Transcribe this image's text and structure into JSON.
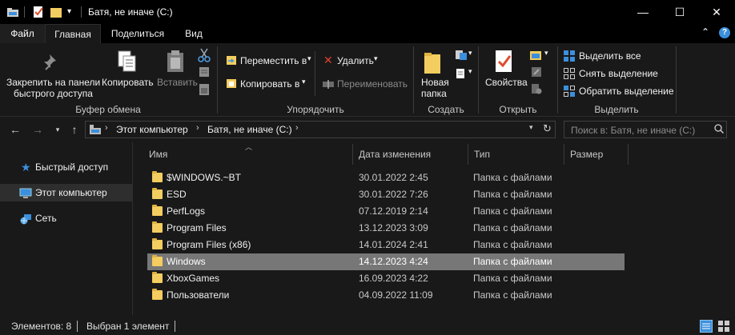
{
  "window": {
    "title": "Батя, не иначе (C:)",
    "minimize_glyph": "—",
    "maximize_glyph": "☐",
    "close_glyph": "✕"
  },
  "ribbon_tabs": {
    "file": "Файл",
    "home": "Главная",
    "share": "Поделиться",
    "view": "Вид"
  },
  "ribbon": {
    "pin_line1": "Закрепить на панели",
    "pin_line2": "быстрого доступа",
    "copy": "Копировать",
    "paste": "Вставить",
    "clipboard_group": "Буфер обмена",
    "move_to": "Переместить в",
    "copy_to": "Копировать в",
    "delete": "Удалить",
    "rename": "Переименовать",
    "organize_group": "Упорядочить",
    "new_folder_line1": "Новая",
    "new_folder_line2": "папка",
    "create_group": "Создать",
    "properties": "Свойства",
    "open_group": "Открыть",
    "select_all": "Выделить все",
    "select_none": "Снять выделение",
    "invert_selection": "Обратить выделение",
    "select_group": "Выделить"
  },
  "address": {
    "crumb1": "Этот компьютер",
    "crumb2": "Батя, не иначе (C:)",
    "search_placeholder": "Поиск в: Батя, не иначе (C:)"
  },
  "nav": {
    "quick_access": "Быстрый доступ",
    "this_pc": "Этот компьютер",
    "network": "Сеть"
  },
  "columns": {
    "name": "Имя",
    "date": "Дата изменения",
    "type": "Тип",
    "size": "Размер"
  },
  "files": [
    {
      "name": "$WINDOWS.~BT",
      "date": "30.01.2022 2:45",
      "type": "Папка с файлами"
    },
    {
      "name": "ESD",
      "date": "30.01.2022 7:26",
      "type": "Папка с файлами"
    },
    {
      "name": "PerfLogs",
      "date": "07.12.2019 2:14",
      "type": "Папка с файлами"
    },
    {
      "name": "Program Files",
      "date": "13.12.2023 3:09",
      "type": "Папка с файлами"
    },
    {
      "name": "Program Files (x86)",
      "date": "14.01.2024 2:41",
      "type": "Папка с файлами"
    },
    {
      "name": "Windows",
      "date": "14.12.2023 4:24",
      "type": "Папка с файлами"
    },
    {
      "name": "XboxGames",
      "date": "16.09.2023 4:22",
      "type": "Папка с файлами"
    },
    {
      "name": "Пользователи",
      "date": "04.09.2022 11:09",
      "type": "Папка с файлами"
    }
  ],
  "status": {
    "count": "Элементов: 8",
    "selected": "Выбран 1 элемент"
  },
  "colors": {
    "background": "#191919",
    "titlebar": "#000000",
    "selection": "#777777",
    "folder": "#f3cd5f",
    "accent_blue": "#3c8fdc"
  }
}
